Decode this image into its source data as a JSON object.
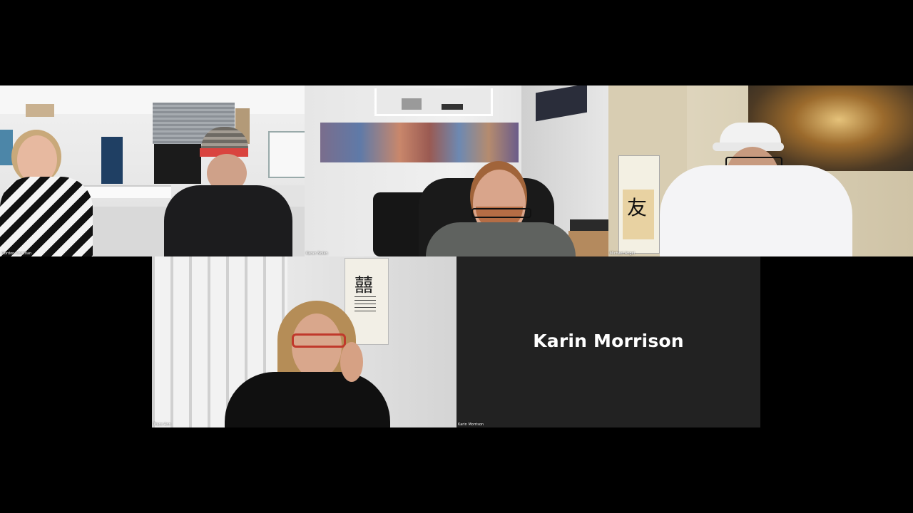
{
  "participants": [
    {
      "name": "Gordon Christian"
    },
    {
      "name": "Karan Nolan"
    },
    {
      "name": "Michael Angel"
    },
    {
      "name": "Trace Ann"
    },
    {
      "name": "Karin Morrison",
      "display_name": "Karin Morrison"
    }
  ],
  "icons": {
    "scroll_left_char": "友",
    "scroll_right_char": "囍"
  },
  "colors": {
    "background": "#000000",
    "camera_off_tile": "#222222",
    "name_text": "#ffffff"
  }
}
